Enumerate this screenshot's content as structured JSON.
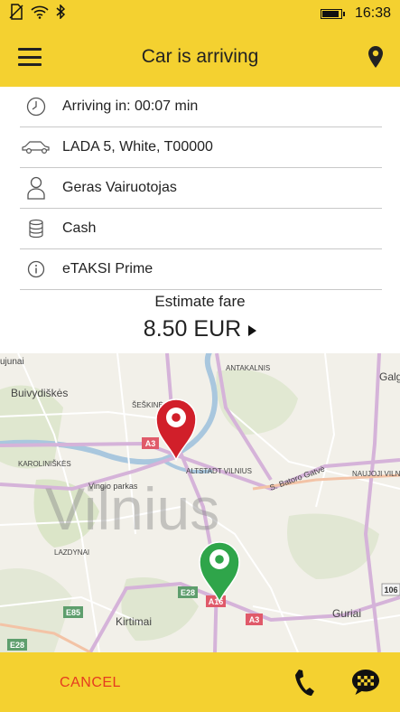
{
  "status_bar": {
    "time": "16:38",
    "battery_level": 0.95
  },
  "header": {
    "title": "Car is arriving",
    "menu_icon": "hamburger-icon",
    "location_icon": "map-pin-icon"
  },
  "ride_info": [
    {
      "icon": "clock-icon",
      "text": "Arriving in: 00:07 min"
    },
    {
      "icon": "car-icon",
      "text": "LADA 5, White, T00000"
    },
    {
      "icon": "driver-icon",
      "text": "Geras Vairuotojas"
    },
    {
      "icon": "coins-icon",
      "text": "Cash"
    },
    {
      "icon": "info-icon",
      "text": "eTAKSI Prime"
    }
  ],
  "fare": {
    "label": "Estimate fare",
    "value": "8.50 EUR"
  },
  "map": {
    "city_label": "Vilnius",
    "place_labels": [
      "Buivydiškės",
      "ŠEŠKINĖ",
      "ANTAKALNIS",
      "KAROLINIŠKĖS",
      "ALTSTADT VILNIUS",
      "Vingio parkas",
      "LAZDYNAI",
      "NAUJOJI VILNIA",
      "Kirtimai",
      "Guriai",
      "S. Batoro Gatvė",
      "Galg",
      "ujunai"
    ],
    "road_labels": [
      "A3",
      "E28",
      "A16",
      "E85",
      "E28",
      "A3",
      "106"
    ],
    "pickup_color": "#d11f2a",
    "destination_color": "#2fa54a"
  },
  "footer": {
    "cancel_label": "CANCEL",
    "phone_icon": "phone-icon",
    "chat_icon": "taxi-chat-icon"
  }
}
